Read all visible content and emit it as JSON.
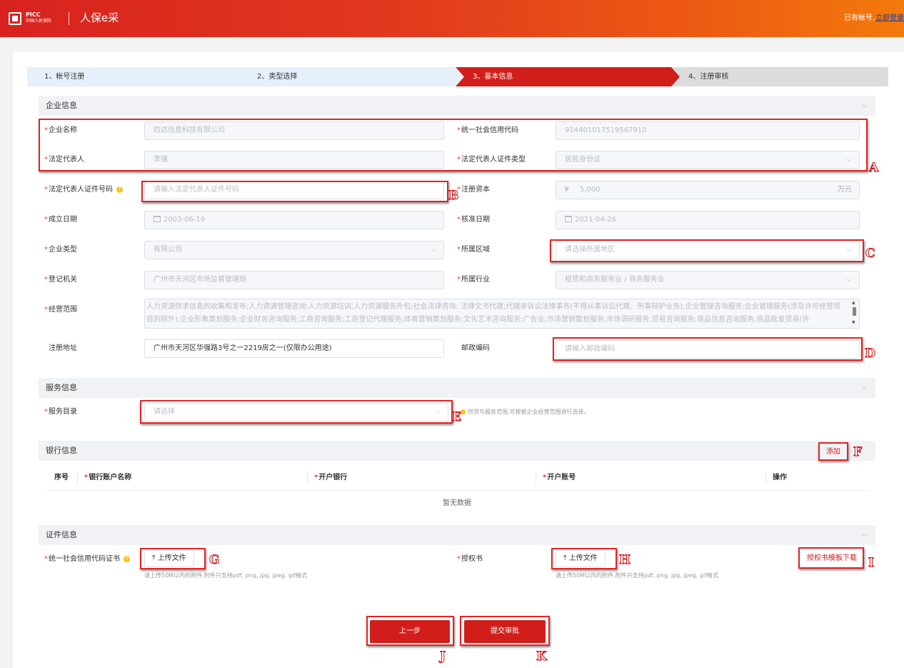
{
  "header": {
    "logo_picc": "PICC",
    "logo_sub": "中国人民保险",
    "app_title": "人保e采",
    "login_prompt": "已有帐号,",
    "login_link": "立即登录"
  },
  "steps": [
    {
      "label": "1、帐号注册"
    },
    {
      "label": "2、类型选择"
    },
    {
      "label": "3、基本信息"
    },
    {
      "label": "4、注册审核"
    }
  ],
  "sections": {
    "company": "企业信息",
    "service": "服务信息",
    "bank": "银行信息",
    "certificate": "证件信息"
  },
  "company": {
    "name": {
      "label": "企业名称",
      "value": "四达信息科技有限公司"
    },
    "credit_code": {
      "label": "统一社会信用代码",
      "value": "914401017519567910"
    },
    "legal_rep": {
      "label": "法定代表人",
      "value": "李强"
    },
    "legal_rep_id_type": {
      "label": "法定代表人证件类型",
      "value": "居民身份证"
    },
    "legal_rep_id_no": {
      "label": "法定代表人证件号码",
      "placeholder": "请输入法定代表人证件号码"
    },
    "reg_capital": {
      "label": "注册资本",
      "prefix": "¥",
      "value": "5,000",
      "unit": "万元"
    },
    "established": {
      "label": "成立日期",
      "value": "2003-06-19"
    },
    "approved": {
      "label": "核准日期",
      "value": "2021-04-26"
    },
    "company_type": {
      "label": "企业类型",
      "value": "有限公司"
    },
    "region": {
      "label": "所属区域",
      "placeholder": "请选择所属地区"
    },
    "reg_authority": {
      "label": "登记机关",
      "value": "广州市天河区市场监督管理局"
    },
    "industry": {
      "label": "所属行业",
      "value": "租赁和商务服务业 / 商务服务业"
    },
    "business_scope": {
      "label": "经营范围",
      "value": "人力资源供求信息的收集和发布;人力资源管理咨询;人力资源培训;人力资源服务外包;社会法律咨询; 法律文书代理;代理非诉讼法律事务(不得从事诉讼代理、刑事辩护业务);企业管理咨询服务;企业管理服务(涉及许可经营项目的除外);企业形象策划服务;企业财务咨询服务;工商咨询服务;工商登记代理服务;体育营销策划服务;文化艺术咨询服务;广告业;市场营销策划服务;市场调研服务;贸易咨询服务;商品信息咨询服务;商品批发贸易(许"
    },
    "reg_address": {
      "label": "注册地址",
      "value": "广州市天河区华强路3号之一2219房之一(仅限办公用途)"
    },
    "postcode": {
      "label": "邮政编码",
      "placeholder": "请输入邮政编码"
    }
  },
  "service": {
    "catalog": {
      "label": "服务目录",
      "placeholder": "请选择"
    },
    "note": "供货与服务范围,可根据企业经营范围进行选择。"
  },
  "bank": {
    "add_label": "添加",
    "columns": [
      "序号",
      "银行账户名称",
      "开户银行",
      "开户账号",
      "操作"
    ],
    "empty": "暂无数据"
  },
  "cert": {
    "credit_cert": {
      "label": "统一社会信用代码证书",
      "button": "上传文件",
      "hint": "请上传50M以内的附件,附件只支持pdf, png, jpg, jpeg, gif格式"
    },
    "authorization": {
      "label": "授权书",
      "button": "上传文件",
      "hint": "请上传50M以内的附件,附件只支持pdf, png, jpg, jpeg, gif格式"
    },
    "template_link": "授权书模板下载"
  },
  "actions": {
    "prev": "上一步",
    "submit": "提交审批"
  },
  "markers": [
    "A",
    "B",
    "C",
    "D",
    "E",
    "F",
    "G",
    "H",
    "I",
    "J",
    "K"
  ],
  "colors": {
    "brand_red": "#d21e1b",
    "header_orange": "#f27a0b",
    "annotation_red": "#e32323"
  }
}
